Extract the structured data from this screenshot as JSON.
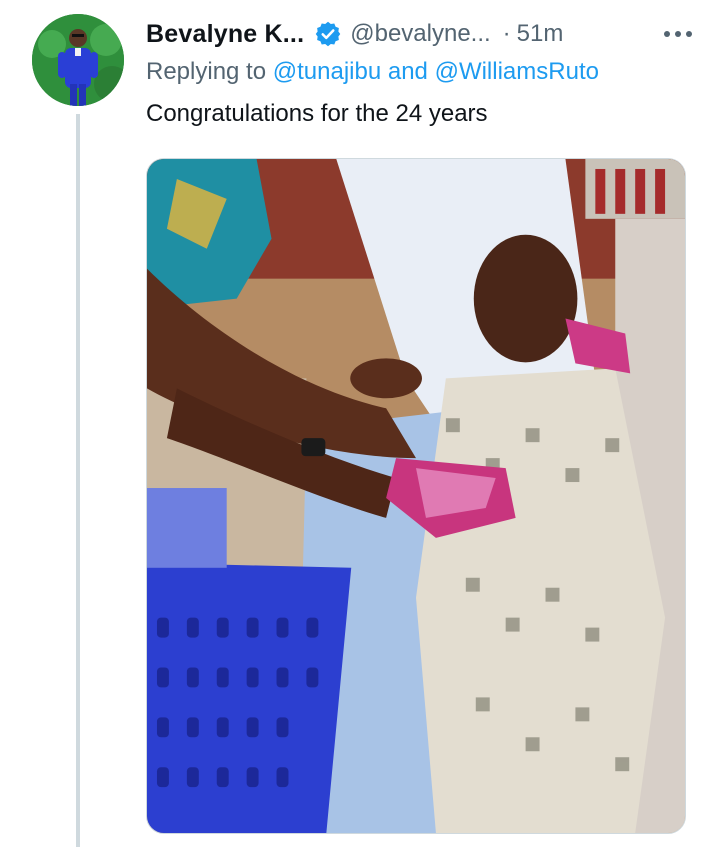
{
  "tweet": {
    "display_name": "Bevalyne K...",
    "handle": "@bevalyne...",
    "separator": "·",
    "time": "51m",
    "replying_prefix": "Replying to",
    "reply_user_1": "@tunajibu",
    "reply_and": "and",
    "reply_user_2": "@WilliamsRuto",
    "text": "Congratulations for the 24 years"
  },
  "icons": {
    "verified": "verified-badge-icon",
    "more": "more-options-icon"
  },
  "colors": {
    "link": "#1d9bf0",
    "secondary_text": "#536471",
    "primary_text": "#0f1419",
    "verified": "#1d9bf0",
    "thread_line": "#cfd9de"
  }
}
